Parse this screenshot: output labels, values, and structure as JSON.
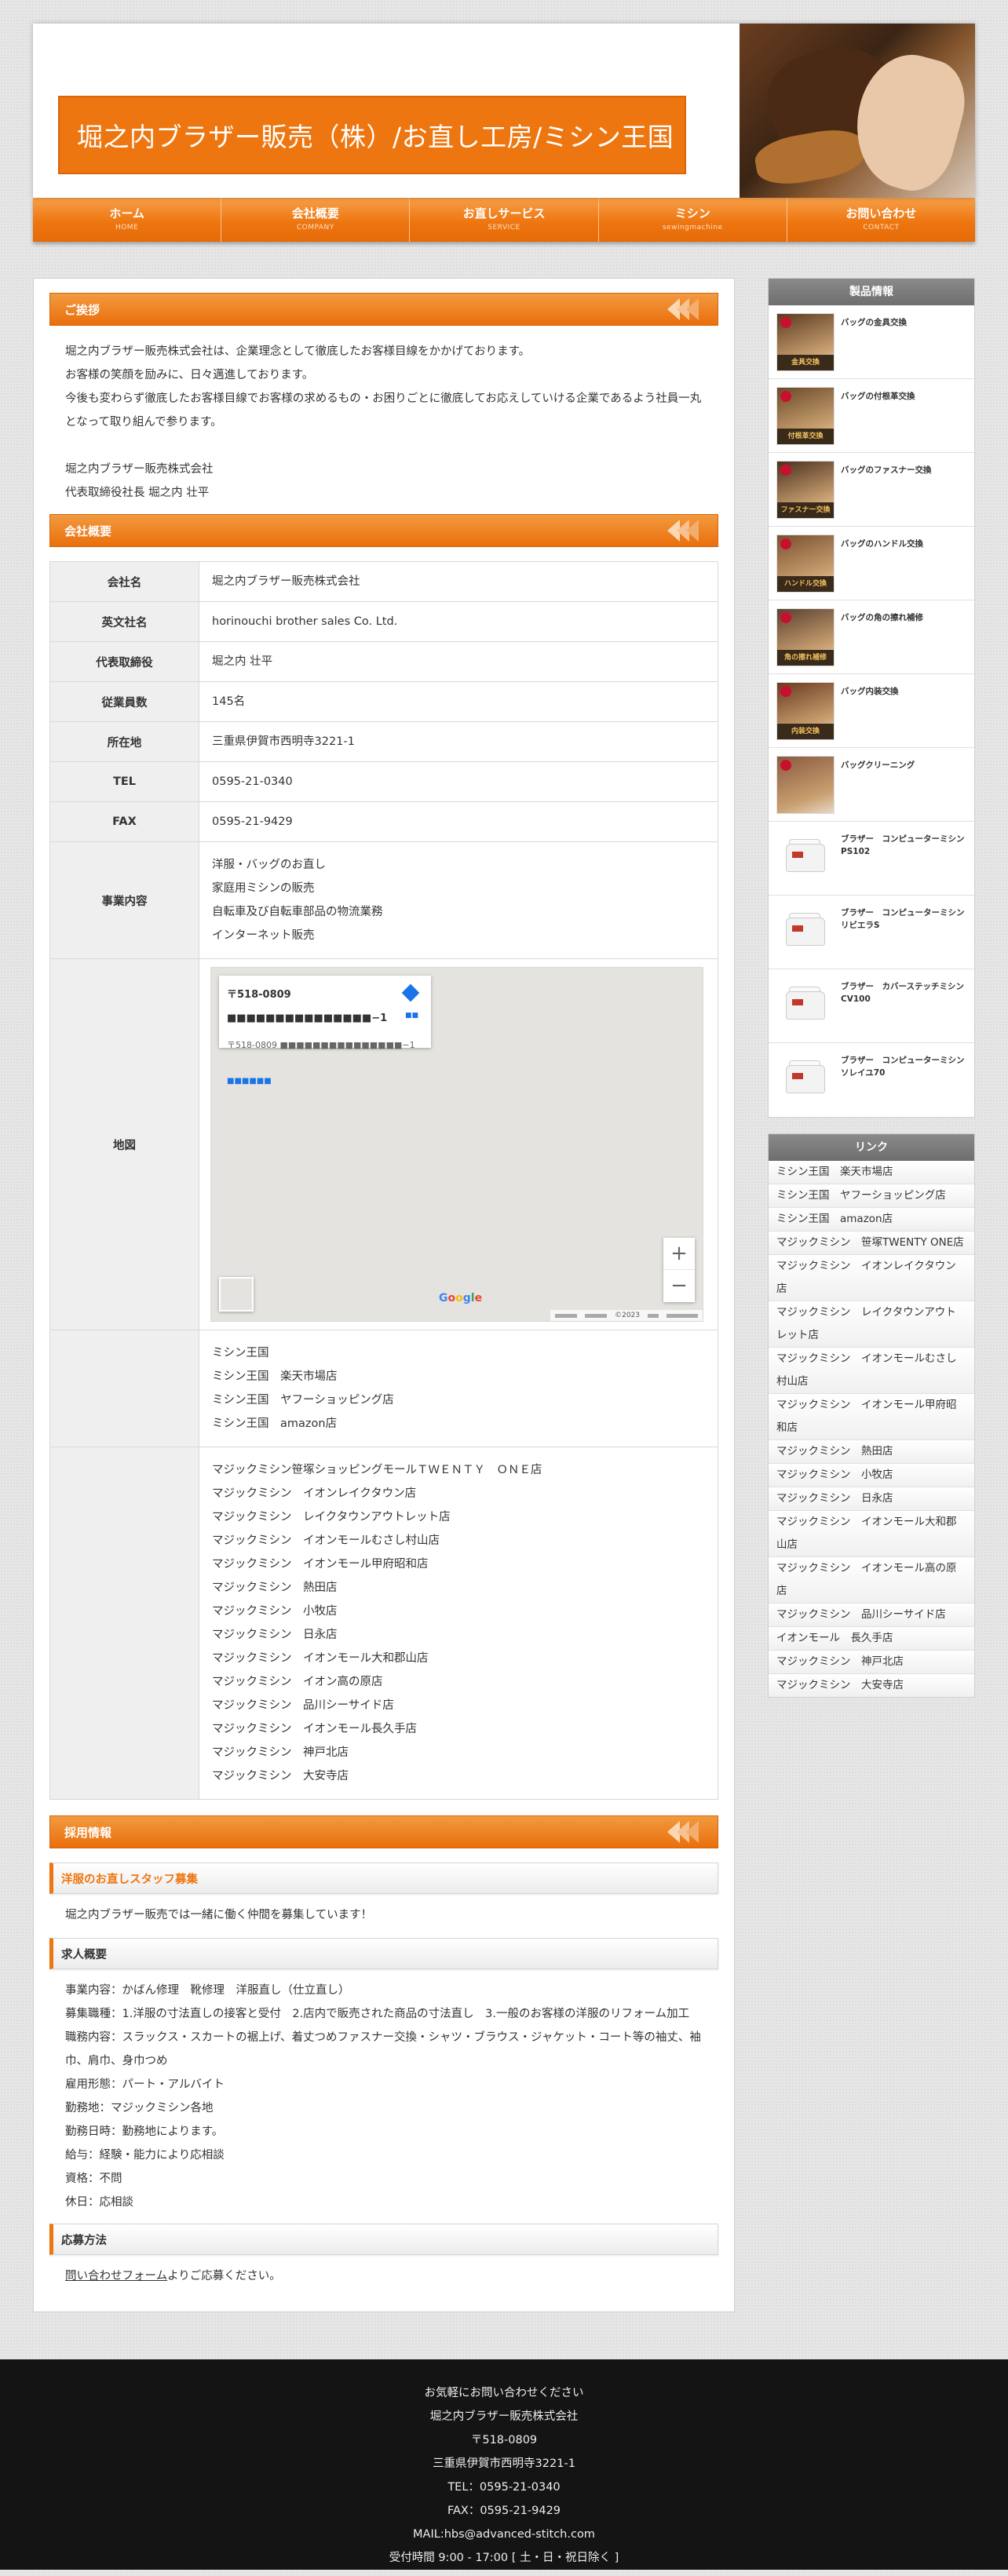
{
  "site_title": "堀之内ブラザー販売（株）/お直し工房/ミシン王国",
  "nav": [
    {
      "jp": "ホーム",
      "en": "HOME"
    },
    {
      "jp": "会社概要",
      "en": "COMPANY"
    },
    {
      "jp": "お直しサービス",
      "en": "SERVICE"
    },
    {
      "jp": "ミシン",
      "en": "sewingmachine"
    },
    {
      "jp": "お問い合わせ",
      "en": "CONTACT"
    }
  ],
  "greeting": {
    "heading": "ご挨拶",
    "lines": [
      "堀之内ブラザー販売株式会社は、企業理念として徹底したお客様目線をかかげております。",
      "お客様の笑顔を励みに、日々邁進しております。",
      "今後も変わらず徹底したお客様目線でお客様の求めるもの・お困りごとに徹底してお応えしていける企業であるよう社員一丸となって取り組んで参ります。"
    ],
    "company_name": "堀之内ブラザー販売株式会社",
    "signature": "代表取締役社長 堀之内 壮平"
  },
  "company": {
    "heading": "会社概要",
    "rows": [
      {
        "label": "会社名",
        "value": "堀之内ブラザー販売株式会社"
      },
      {
        "label": "英文社名",
        "value": "horinouchi brother sales Co. Ltd."
      },
      {
        "label": "代表取締役",
        "value": "堀之内 壮平"
      },
      {
        "label": "従業員数",
        "value": "145名"
      },
      {
        "label": "所在地",
        "value": "三重県伊賀市西明寺3221-1"
      },
      {
        "label": "TEL",
        "value": "0595-21-0340"
      },
      {
        "label": "FAX",
        "value": "0595-21-9429"
      }
    ],
    "business_label": "事業内容",
    "business": [
      "洋服・バッグのお直し",
      "家庭用ミシンの販売",
      "自転車及び自転車部品の物流業務",
      "インターネット販売"
    ],
    "map_label": "地図",
    "map": {
      "card_title": "〒518-0809 ■■■■■■■■■■■■■■■−1",
      "card_addr": "〒518-0809 ■■■■■■■■■■■■■■■−1",
      "card_link": "■■■■■■",
      "dir_label": "■■",
      "zoom_in": "+",
      "zoom_out": "−",
      "copyright": "©2023"
    },
    "stores_online": [
      "ミシン王国",
      "ミシン王国　楽天市場店",
      "ミシン王国　ヤフーショッピング店",
      "ミシン王国　amazon店"
    ],
    "stores_retail": [
      "マジックミシン笹塚ショッピングモールＴＷＥＮＴＹ　ＯＮＥ店",
      "マジックミシン　イオンレイクタウン店",
      "マジックミシン　レイクタウンアウトレット店",
      "マジックミシン　イオンモールむさし村山店",
      "マジックミシン　イオンモール甲府昭和店",
      "マジックミシン　熱田店",
      "マジックミシン　小牧店",
      "マジックミシン　日永店",
      "マジックミシン　イオンモール大和郡山店",
      "マジックミシン　イオン高の原店",
      "マジックミシン　品川シーサイド店",
      "マジックミシン　イオンモール長久手店",
      "マジックミシン　神戸北店",
      "マジックミシン　大安寺店"
    ]
  },
  "recruit": {
    "heading": "採用情報",
    "staff_heading": "洋服のお直しスタッフ募集",
    "staff_text": "堀之内ブラザー販売では一緒に働く仲間を募集しています！",
    "summary_heading": "求人概要",
    "summary": [
      "事業内容：かばん修理　靴修理　洋服直し（仕立直し）",
      "募集職種：1.洋服の寸法直しの接客と受付　2.店内で販売された商品の寸法直し　3.一般のお客様の洋服のリフォーム加工",
      "職務内容：スラックス・スカートの裾上げ、着丈つめファスナー交換・シャツ・ブラウス・ジャケット・コート等の袖丈、袖巾、肩巾、身巾つめ",
      "雇用形態：パート・アルバイト",
      "勤務地：マジックミシン各地",
      "勤務日時：勤務地によります。",
      "給与：経験・能力により応相談",
      "資格：不問",
      "休日：応相談"
    ],
    "apply_heading": "応募方法",
    "apply_link": "問い合わせフォーム",
    "apply_text": "よりご応募ください。"
  },
  "side_products": {
    "heading": "製品情報",
    "items": [
      {
        "title": "バッグの金具交換",
        "cap": "金具交換",
        "color": "#5a3a20"
      },
      {
        "title": "バッグの付根革交換",
        "cap": "付根革交換",
        "color": "#6a4a2a"
      },
      {
        "title": "バッグのファスナー交換",
        "cap": "ファスナー交換",
        "color": "#4a3020"
      },
      {
        "title": "バッグのハンドル交換",
        "cap": "ハンドル交換",
        "color": "#7a5030"
      },
      {
        "title": "バッグの角の擦れ補修",
        "cap": "角の擦れ補修",
        "color": "#5a4030"
      },
      {
        "title": "バッグ内装交換",
        "cap": "内装交換",
        "color": "#6a3a20"
      },
      {
        "title": "バッグクリーニング",
        "cap": "",
        "color": "#8a5a40"
      },
      {
        "title": "ブラザー　コンピューターミシン　PS102",
        "cap": "",
        "machine": true
      },
      {
        "title": "ブラザー　コンピューターミシン　リビエラS",
        "cap": "",
        "machine": true
      },
      {
        "title": "ブラザー　カバーステッチミシン　CV100",
        "cap": "",
        "machine": true
      },
      {
        "title": "ブラザー　コンピューターミシン　ソレイユ70",
        "cap": "",
        "machine": true
      }
    ]
  },
  "side_links": {
    "heading": "リンク",
    "items": [
      "ミシン王国　楽天市場店",
      "ミシン王国　ヤフーショッピング店",
      "ミシン王国　amazon店",
      "マジックミシン　笹塚TWENTY ONE店",
      "マジックミシン　イオンレイクタウン店",
      "マジックミシン　レイクタウンアウトレット店",
      "マジックミシン　イオンモールむさし村山店",
      "マジックミシン　イオンモール甲府昭和店",
      "マジックミシン　熱田店",
      "マジックミシン　小牧店",
      "マジックミシン　日永店",
      "マジックミシン　イオンモール大和郡山店",
      "マジックミシン　イオンモール高の原店",
      "マジックミシン　品川シーサイド店",
      "イオンモール　長久手店",
      "マジックミシン　神戸北店",
      "マジックミシン　大安寺店"
    ]
  },
  "footer": {
    "lines": [
      "お気軽にお問い合わせください",
      "堀之内ブラザー販売株式会社",
      "〒518-0809",
      "三重県伊賀市西明寺3221-1",
      "TEL：0595-21-0340",
      "FAX：0595-21-9429",
      "MAIL:hbs@advanced-stitch.com",
      "受付時間 9:00 - 17:00 [ 土・日・祝日除く ]"
    ]
  }
}
